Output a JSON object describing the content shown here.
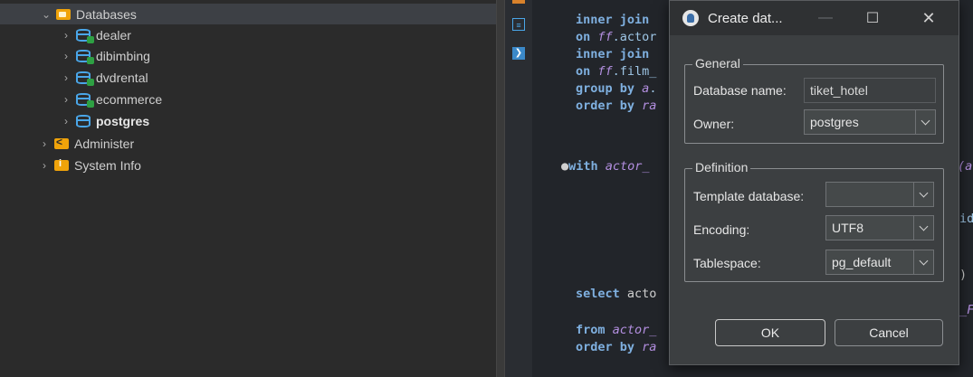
{
  "tree": {
    "items": [
      {
        "label": "Databases",
        "expanded": true
      },
      {
        "label": "dealer"
      },
      {
        "label": "dibimbing"
      },
      {
        "label": "dvdrental"
      },
      {
        "label": "ecommerce"
      },
      {
        "label": "postgres"
      },
      {
        "label": "Administer"
      },
      {
        "label": "System Info"
      }
    ]
  },
  "editor": {
    "lines": [
      {
        "kw": "inner join",
        "rest": ""
      },
      {
        "kw": "on",
        "it": "ff",
        "rest": ".actor"
      },
      {
        "kw": "inner join",
        "rest": ""
      },
      {
        "kw": "on",
        "it": "ff",
        "rest": ".film_"
      },
      {
        "kw": "group by",
        "it": "a",
        "rest": "."
      },
      {
        "kw": "order by",
        "it": "ra",
        "rest": ""
      },
      {
        "kw": "with",
        "it": "actor_",
        "rest": ""
      },
      {
        "kw": "select",
        "rest": "acto"
      },
      {
        "kw": "from",
        "it": "actor_",
        "rest": ""
      },
      {
        "kw": "order by",
        "it": "ra",
        "rest": ""
      }
    ],
    "right_fragments": [
      "(a",
      "id",
      ")",
      "_F"
    ]
  },
  "dialog": {
    "title": "Create dat...",
    "general": {
      "label": "General",
      "db_name_label": "Database name:",
      "db_name_value": "tiket_hotel",
      "owner_label": "Owner:",
      "owner_value": "postgres"
    },
    "definition": {
      "label": "Definition",
      "template_label": "Template database:",
      "template_value": "",
      "encoding_label": "Encoding:",
      "encoding_value": "UTF8",
      "tablespace_label": "Tablespace:",
      "tablespace_value": "pg_default"
    },
    "ok_label": "OK",
    "cancel_label": "Cancel"
  }
}
